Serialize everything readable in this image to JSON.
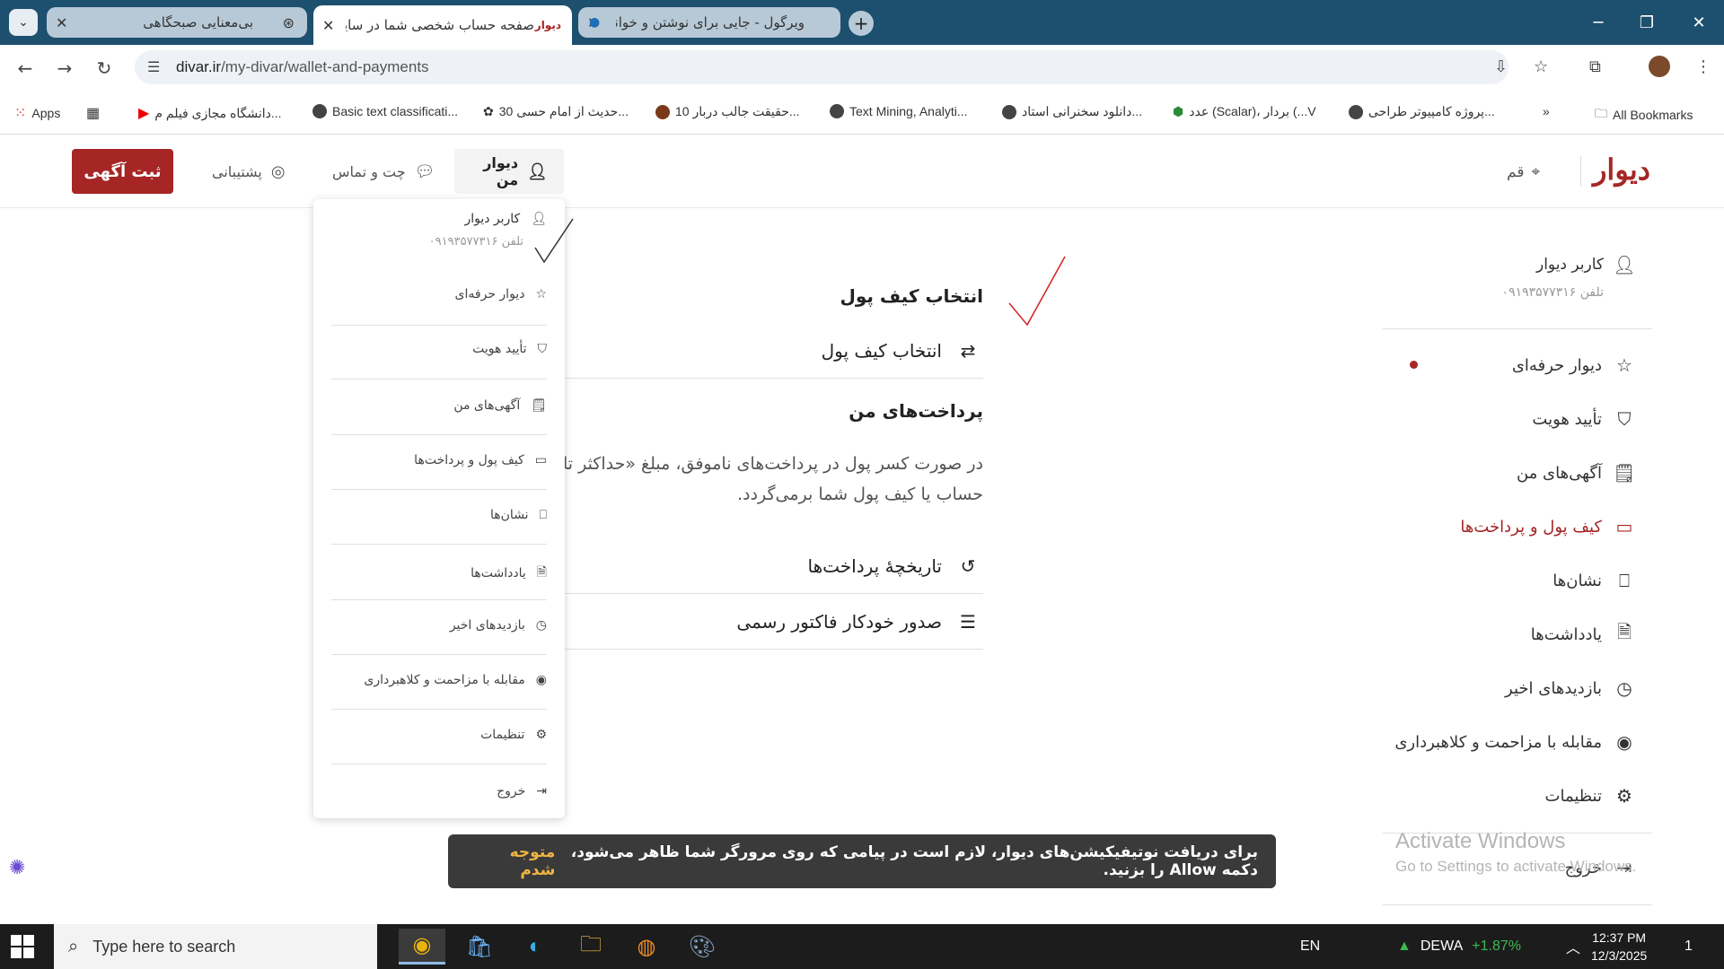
{
  "browser": {
    "tabs": [
      {
        "title": "بی‌معنایی صبحگاهی",
        "icon": "chatgpt-icon",
        "active": false
      },
      {
        "title": "صفحه حساب شخصی شما در سایت",
        "icon": "divar-favicon",
        "active": true
      },
      {
        "title": "ویرگول - جایی برای نوشتن و خواندن",
        "icon": "virgool-icon",
        "active": false
      }
    ],
    "url_host": "divar.ir",
    "url_path": "/my-divar/wallet-and-payments",
    "bookmarks": [
      {
        "label": "Apps"
      },
      {
        "label": "دانشگاه مجازی فیلم م..."
      },
      {
        "label": "Basic text classificati..."
      },
      {
        "label": "30 حدیث از امام حسی..."
      },
      {
        "label": "10 حقیقت جالب دربار..."
      },
      {
        "label": "Text Mining, Analyti..."
      },
      {
        "label": "دانلود سخنرانی استاد..."
      },
      {
        "label": "عدد (Scalar)، بردار (...V"
      },
      {
        "label": "پروژه کامپیوتر طراحی..."
      },
      {
        "label": "All Bookmarks"
      }
    ]
  },
  "header": {
    "logo": "دیوار",
    "city": "قم",
    "nav": {
      "my_divar": "دیوار من",
      "chat": "چت و تماس",
      "support": "پشتیبانی"
    },
    "post_button": "ثبت آگهی"
  },
  "dropdown": {
    "user_name": "کاربر دیوار",
    "user_phone": "تلفن ۰۹۱۹۳۵۷۷۳۱۶",
    "items": [
      "دیوار حرفه‌ای",
      "تأیید هویت",
      "آگهی‌های من",
      "کیف پول و پرداخت‌ها",
      "نشان‌ها",
      "یادداشت‌ها",
      "بازدیدهای اخیر",
      "مقابله با مزاحمت و کلاهبرداری",
      "تنظیمات",
      "خروج"
    ]
  },
  "sidebar": {
    "user_name": "کاربر دیوار",
    "user_phone": "تلفن ۰۹۱۹۳۵۷۷۳۱۶",
    "items": [
      "دیوار حرفه‌ای",
      "تأیید هویت",
      "آگهی‌های من",
      "کیف پول و پرداخت‌ها",
      "نشان‌ها",
      "یادداشت‌ها",
      "بازدیدهای اخیر",
      "مقابله با مزاحمت و کلاهبرداری",
      "تنظیمات",
      "خروج"
    ],
    "selected_index": 3
  },
  "main": {
    "wallet_heading": "انتخاب کیف پول",
    "wallet_row": "انتخاب کیف پول",
    "payments_heading": "پرداخت‌های من",
    "para_line1": "در صورت کسر پول در پرداخت‌های ناموفق، مبلغ «حداکثر تا",
    "para_line2": "حساب یا کیف پول شما برمی‌گردد.",
    "history_row": "تاریخچهٔ پرداخت‌ها",
    "invoice_row": "صدور خودکار فاکتور رسمی"
  },
  "toast": {
    "message": "برای دریافت نوتیفیکیشن‌های دیوار، لازم است در پیامی که روی مرورگر شما ظاهر می‌شود، دکمه Allow را بزنید.",
    "action": "متوجه شدم"
  },
  "watermark": {
    "line1": "Activate Windows",
    "line2": "Go to Settings to activate Windows."
  },
  "taskbar": {
    "search_placeholder": "Type here to search",
    "lang": "EN",
    "stock_name": "DEWA",
    "stock_change": "+1.87%",
    "time": "12:37 PM",
    "date": "12/3/2025",
    "notifications": "1"
  },
  "colors": {
    "brand": "#a62626",
    "tabbar": "#1d4f6e",
    "toast_bg": "#3a3a3a",
    "toast_action": "#f0b441"
  }
}
